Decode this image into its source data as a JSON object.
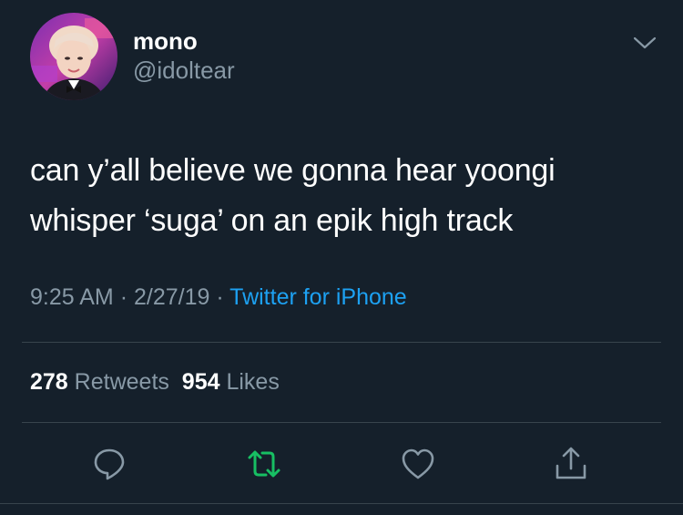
{
  "author": {
    "display_name": "mono",
    "handle": "@idoltear"
  },
  "tweet": {
    "text_line_1": "can y’all believe we gonna hear yoongi",
    "text_line_2": "whisper ‘suga’ on an epik high track"
  },
  "meta": {
    "time": "9:25 AM",
    "separator": "·",
    "date": "2/27/19",
    "source": "Twitter for iPhone"
  },
  "stats": {
    "retweets_count": "278",
    "retweets_label": "Retweets",
    "likes_count": "954",
    "likes_label": "Likes"
  },
  "colors": {
    "background": "#15202b",
    "text_primary": "#ffffff",
    "text_secondary": "#8899a6",
    "link": "#1da1f2",
    "retweet_active": "#17bf63",
    "divider": "#38444d"
  },
  "icons": {
    "menu": "chevron-down-icon",
    "reply": "reply-icon",
    "retweet": "retweet-icon",
    "like": "heart-icon",
    "share": "share-icon"
  }
}
